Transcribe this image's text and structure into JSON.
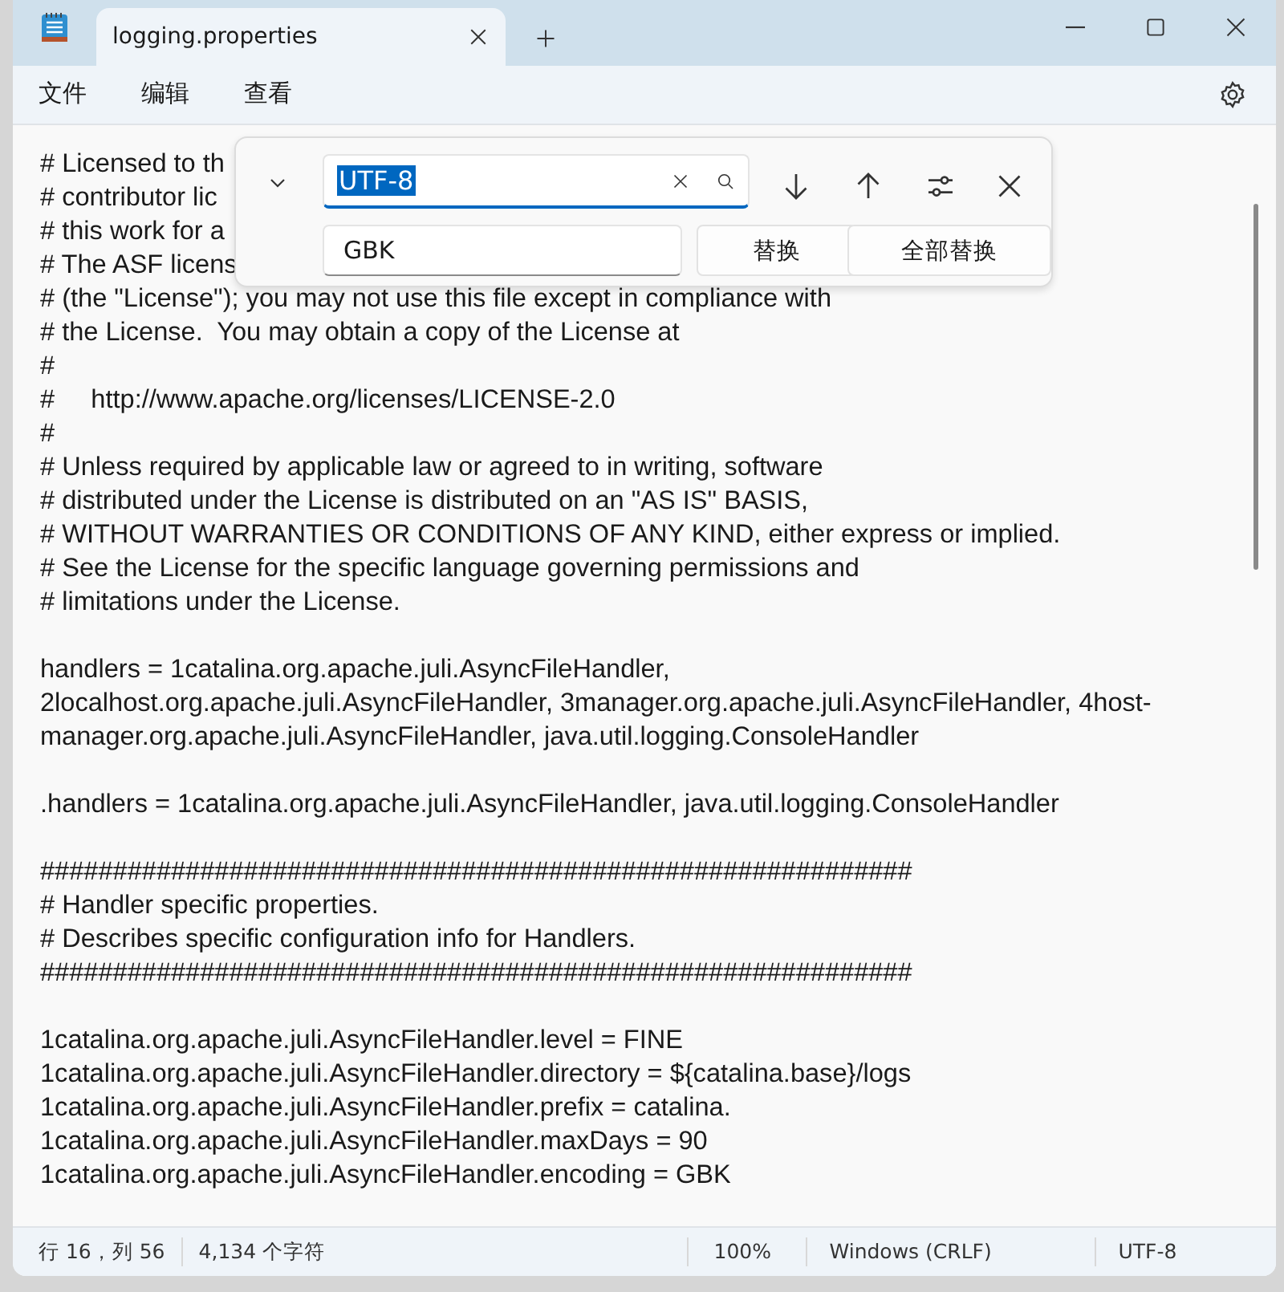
{
  "window": {
    "tab_title": "logging.properties"
  },
  "menu": [
    "文件",
    "编辑",
    "查看"
  ],
  "find_panel": {
    "find_value": "UTF-8",
    "replace_value": "GBK",
    "replace_button": "替换",
    "replace_all_button": "全部替换"
  },
  "editor": {
    "paragraphs": [
      [
        "# Licensed to th",
        "# contributor lic",
        "# this work for a",
        "# The ASF licens",
        "# (the \"License\"); you may not use this file except in compliance with",
        "# the License.  You may obtain a copy of the License at",
        "#",
        "#     http://www.apache.org/licenses/LICENSE-2.0",
        "#",
        "# Unless required by applicable law or agreed to in writing, software",
        "# distributed under the License is distributed on an \"AS IS\" BASIS,",
        "# WITHOUT WARRANTIES OR CONDITIONS OF ANY KIND, either express or implied.",
        "# See the License for the specific language governing permissions and",
        "# limitations under the License."
      ],
      [
        "handlers = 1catalina.org.apache.juli.AsyncFileHandler,",
        "2localhost.org.apache.juli.AsyncFileHandler, 3manager.org.apache.juli.AsyncFileHandler, 4host-",
        "manager.org.apache.juli.AsyncFileHandler, java.util.logging.ConsoleHandler"
      ],
      [
        ".handlers = 1catalina.org.apache.juli.AsyncFileHandler, java.util.logging.ConsoleHandler"
      ],
      [
        "############################################################",
        "# Handler specific properties.",
        "# Describes specific configuration info for Handlers.",
        "############################################################"
      ],
      [
        "1catalina.org.apache.juli.AsyncFileHandler.level = FINE",
        "1catalina.org.apache.juli.AsyncFileHandler.directory = ${catalina.base}/logs",
        "1catalina.org.apache.juli.AsyncFileHandler.prefix = catalina.",
        "1catalina.org.apache.juli.AsyncFileHandler.maxDays = 90",
        "1catalina.org.apache.juli.AsyncFileHandler.encoding = GBK"
      ]
    ]
  },
  "status_bar": {
    "position": "行 16，列 56",
    "characters": "4,134 个字符",
    "zoom": "100%",
    "line_ending": "Windows (CRLF)",
    "encoding": "UTF-8"
  }
}
